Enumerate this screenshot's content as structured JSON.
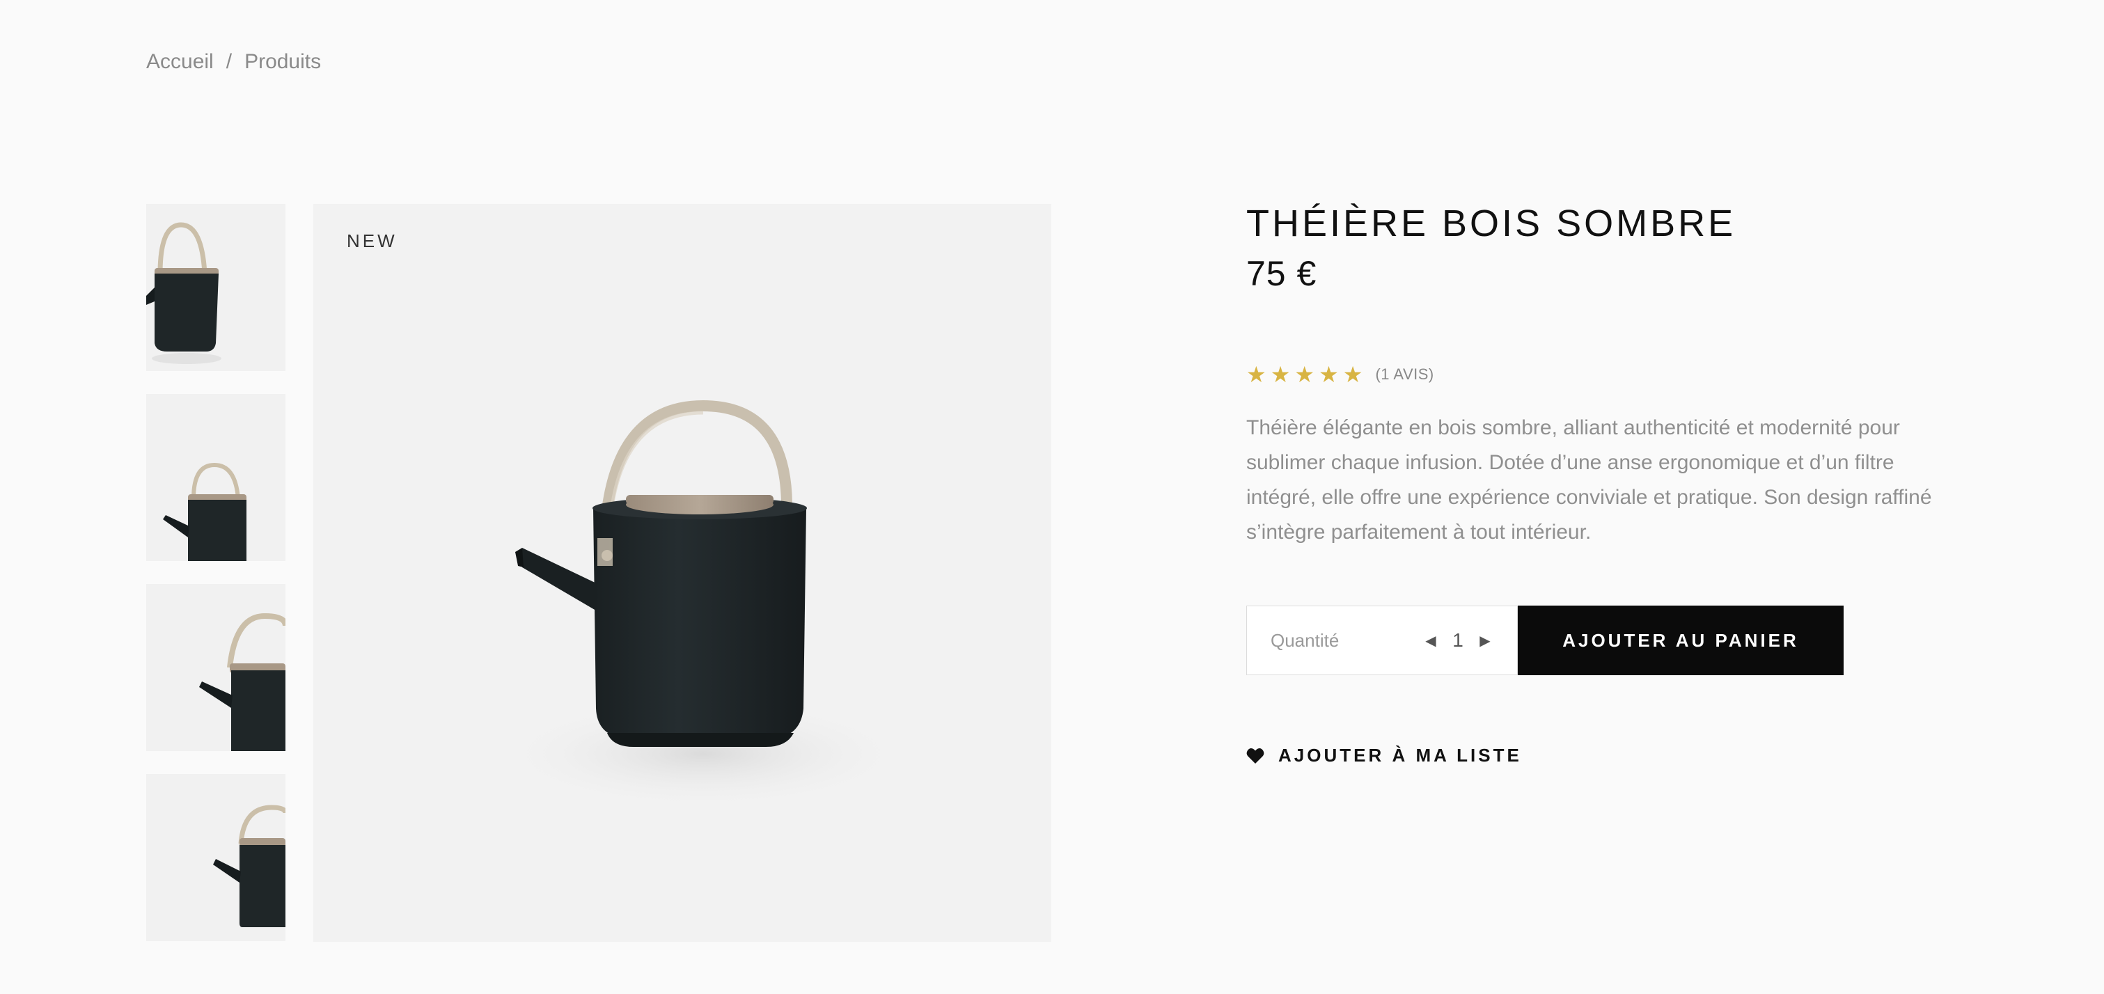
{
  "breadcrumb": {
    "home": "Accueil",
    "separator": "/",
    "current": "Produits"
  },
  "gallery": {
    "badge": "NEW",
    "thumbnails": [
      "teapot-view-1",
      "teapot-view-2",
      "teapot-view-3",
      "teapot-view-4"
    ]
  },
  "product": {
    "title": "THÉIÈRE BOIS SOMBRE",
    "price": "75 €",
    "rating": {
      "stars": 5,
      "max": 5,
      "reviews_label": "(1 AVIS)"
    },
    "description": "Théière élégante en bois sombre, alliant authenticité et modernité pour sublimer chaque infusion. Dotée d’une anse ergonomique et d’un filtre intégré, elle offre une expérience conviviale et pratique. Son design raffiné s’intègre parfaitement à tout intérieur."
  },
  "cart": {
    "quantity_label": "Quantité",
    "quantity_value": "1",
    "add_button": "AJOUTER AU PANIER"
  },
  "wishlist": {
    "label": "AJOUTER À MA LISTE",
    "icon": "heart-icon"
  },
  "colors": {
    "accent_star": "#d8b443",
    "button_bg": "#0b0b0b",
    "teapot_body": "#1d2426",
    "handle": "#c9bfae"
  }
}
